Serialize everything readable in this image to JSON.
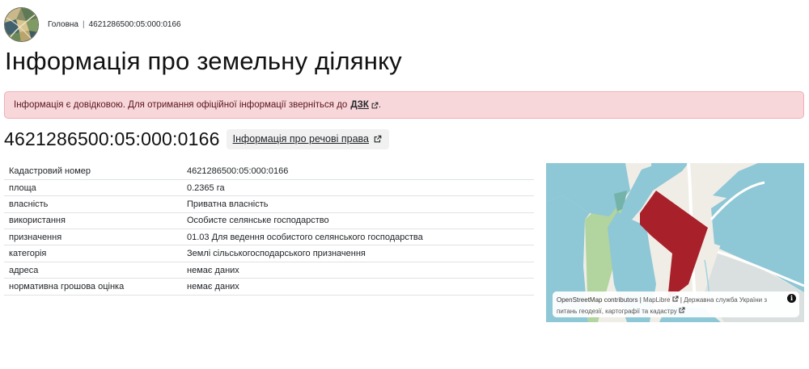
{
  "breadcrumb": {
    "home": "Головна",
    "separator": "|",
    "current": "4621286500:05:000:0166"
  },
  "page": {
    "title": "Інформація про земельну ділянку"
  },
  "alert": {
    "text": "Інформація є довідковою. Для отримання офіційної інформації зверніться до",
    "link": "ДЗК",
    "suffix": "."
  },
  "parcel": {
    "number": "4621286500:05:000:0166",
    "rights_button": "Інформація про речові права"
  },
  "details": [
    {
      "key": "Кадастровий номер",
      "value": "4621286500:05:000:0166"
    },
    {
      "key": "площа",
      "value": "0.2365 га"
    },
    {
      "key": "власність",
      "value": "Приватна власність"
    },
    {
      "key": "використання",
      "value": "Особисте селянське господарство"
    },
    {
      "key": "призначення",
      "value": "01.03 Для ведення особистого селянського господарства"
    },
    {
      "key": "категорія",
      "value": "Землі сільськогосподарського призначення"
    },
    {
      "key": "адреса",
      "value": "немає даних"
    },
    {
      "key": "нормативна грошова оцінка",
      "value": "немає даних"
    }
  ],
  "map": {
    "attribution_osm": "OpenStreetMap contributors",
    "attribution_sep1": "|",
    "attribution_maplibre": "MapLibre",
    "attribution_sep2": "|",
    "attribution_dzk_line1": "Державна служба України з",
    "attribution_dzk_line2": "питань геодезії, картографії та кадастру",
    "info_icon": "i",
    "colors": {
      "parcel": "#a8212a",
      "neighbor": "#8ec7d6",
      "green": "#a7cf90",
      "road": "#ffffff",
      "background": "#f0ede6"
    }
  },
  "colors": {
    "alert_bg": "#f8d7da",
    "alert_border": "#f1aeb5",
    "button_bg": "#f1f1f1"
  }
}
